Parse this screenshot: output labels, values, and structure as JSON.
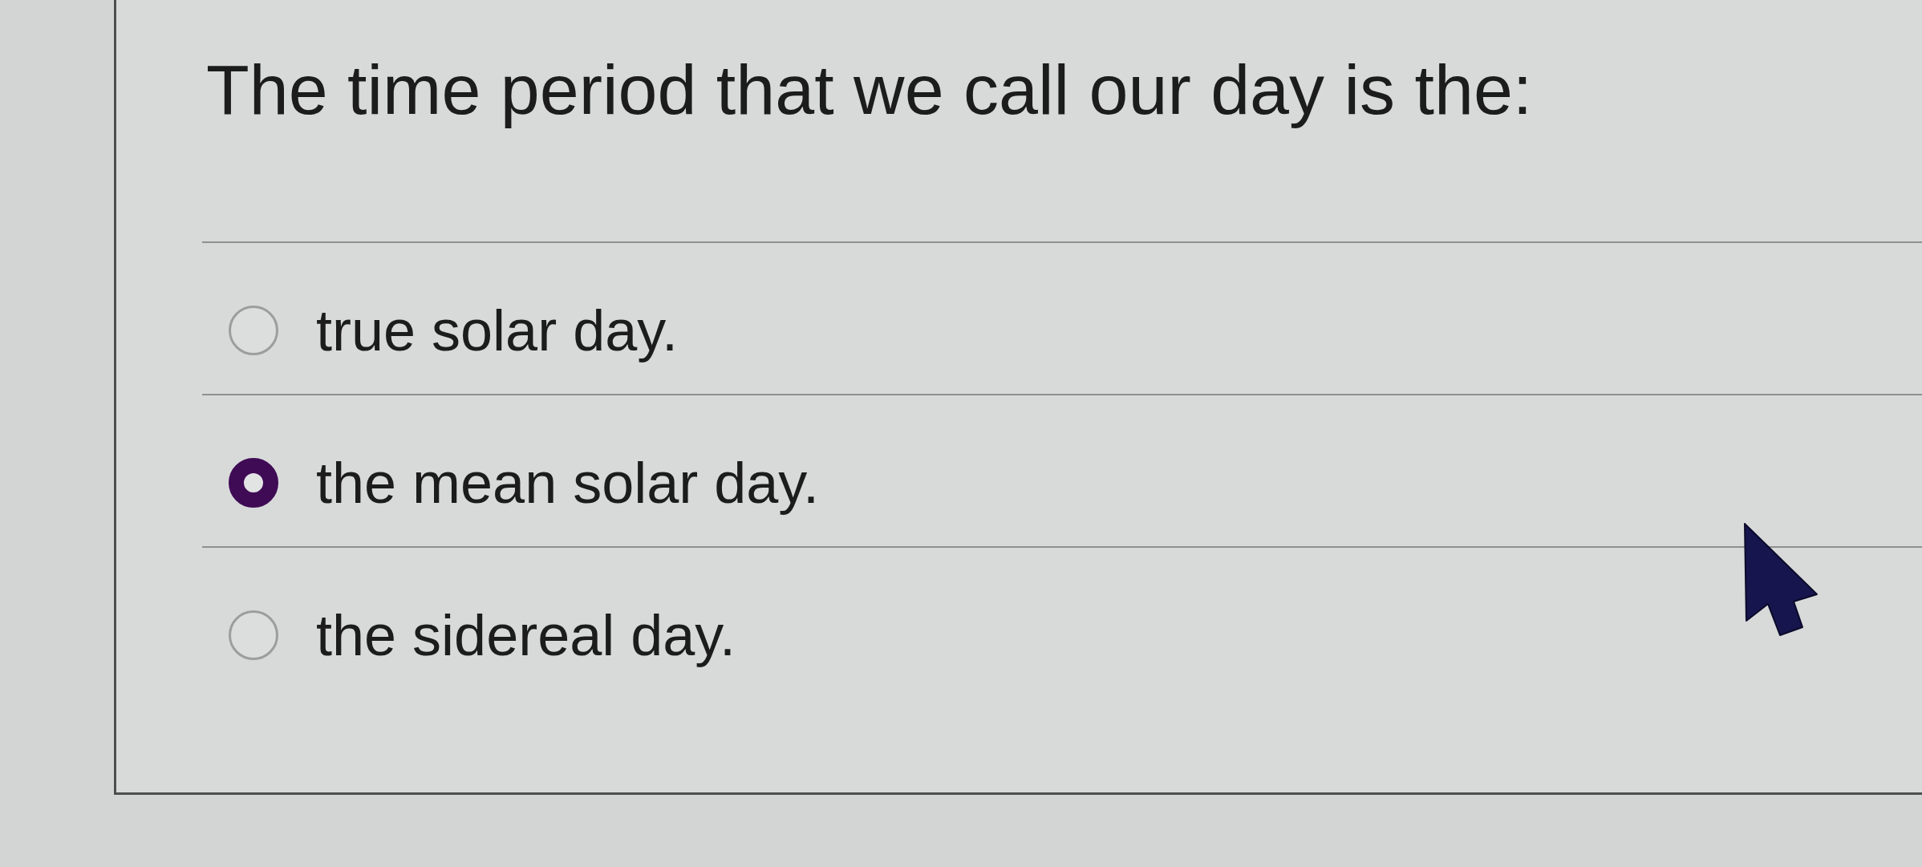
{
  "question": {
    "text": "The time period that we call our day is the:"
  },
  "options": [
    {
      "label": "true solar day.",
      "selected": false
    },
    {
      "label": "the mean solar day.",
      "selected": true
    },
    {
      "label": "the sidereal day.",
      "selected": false
    }
  ]
}
